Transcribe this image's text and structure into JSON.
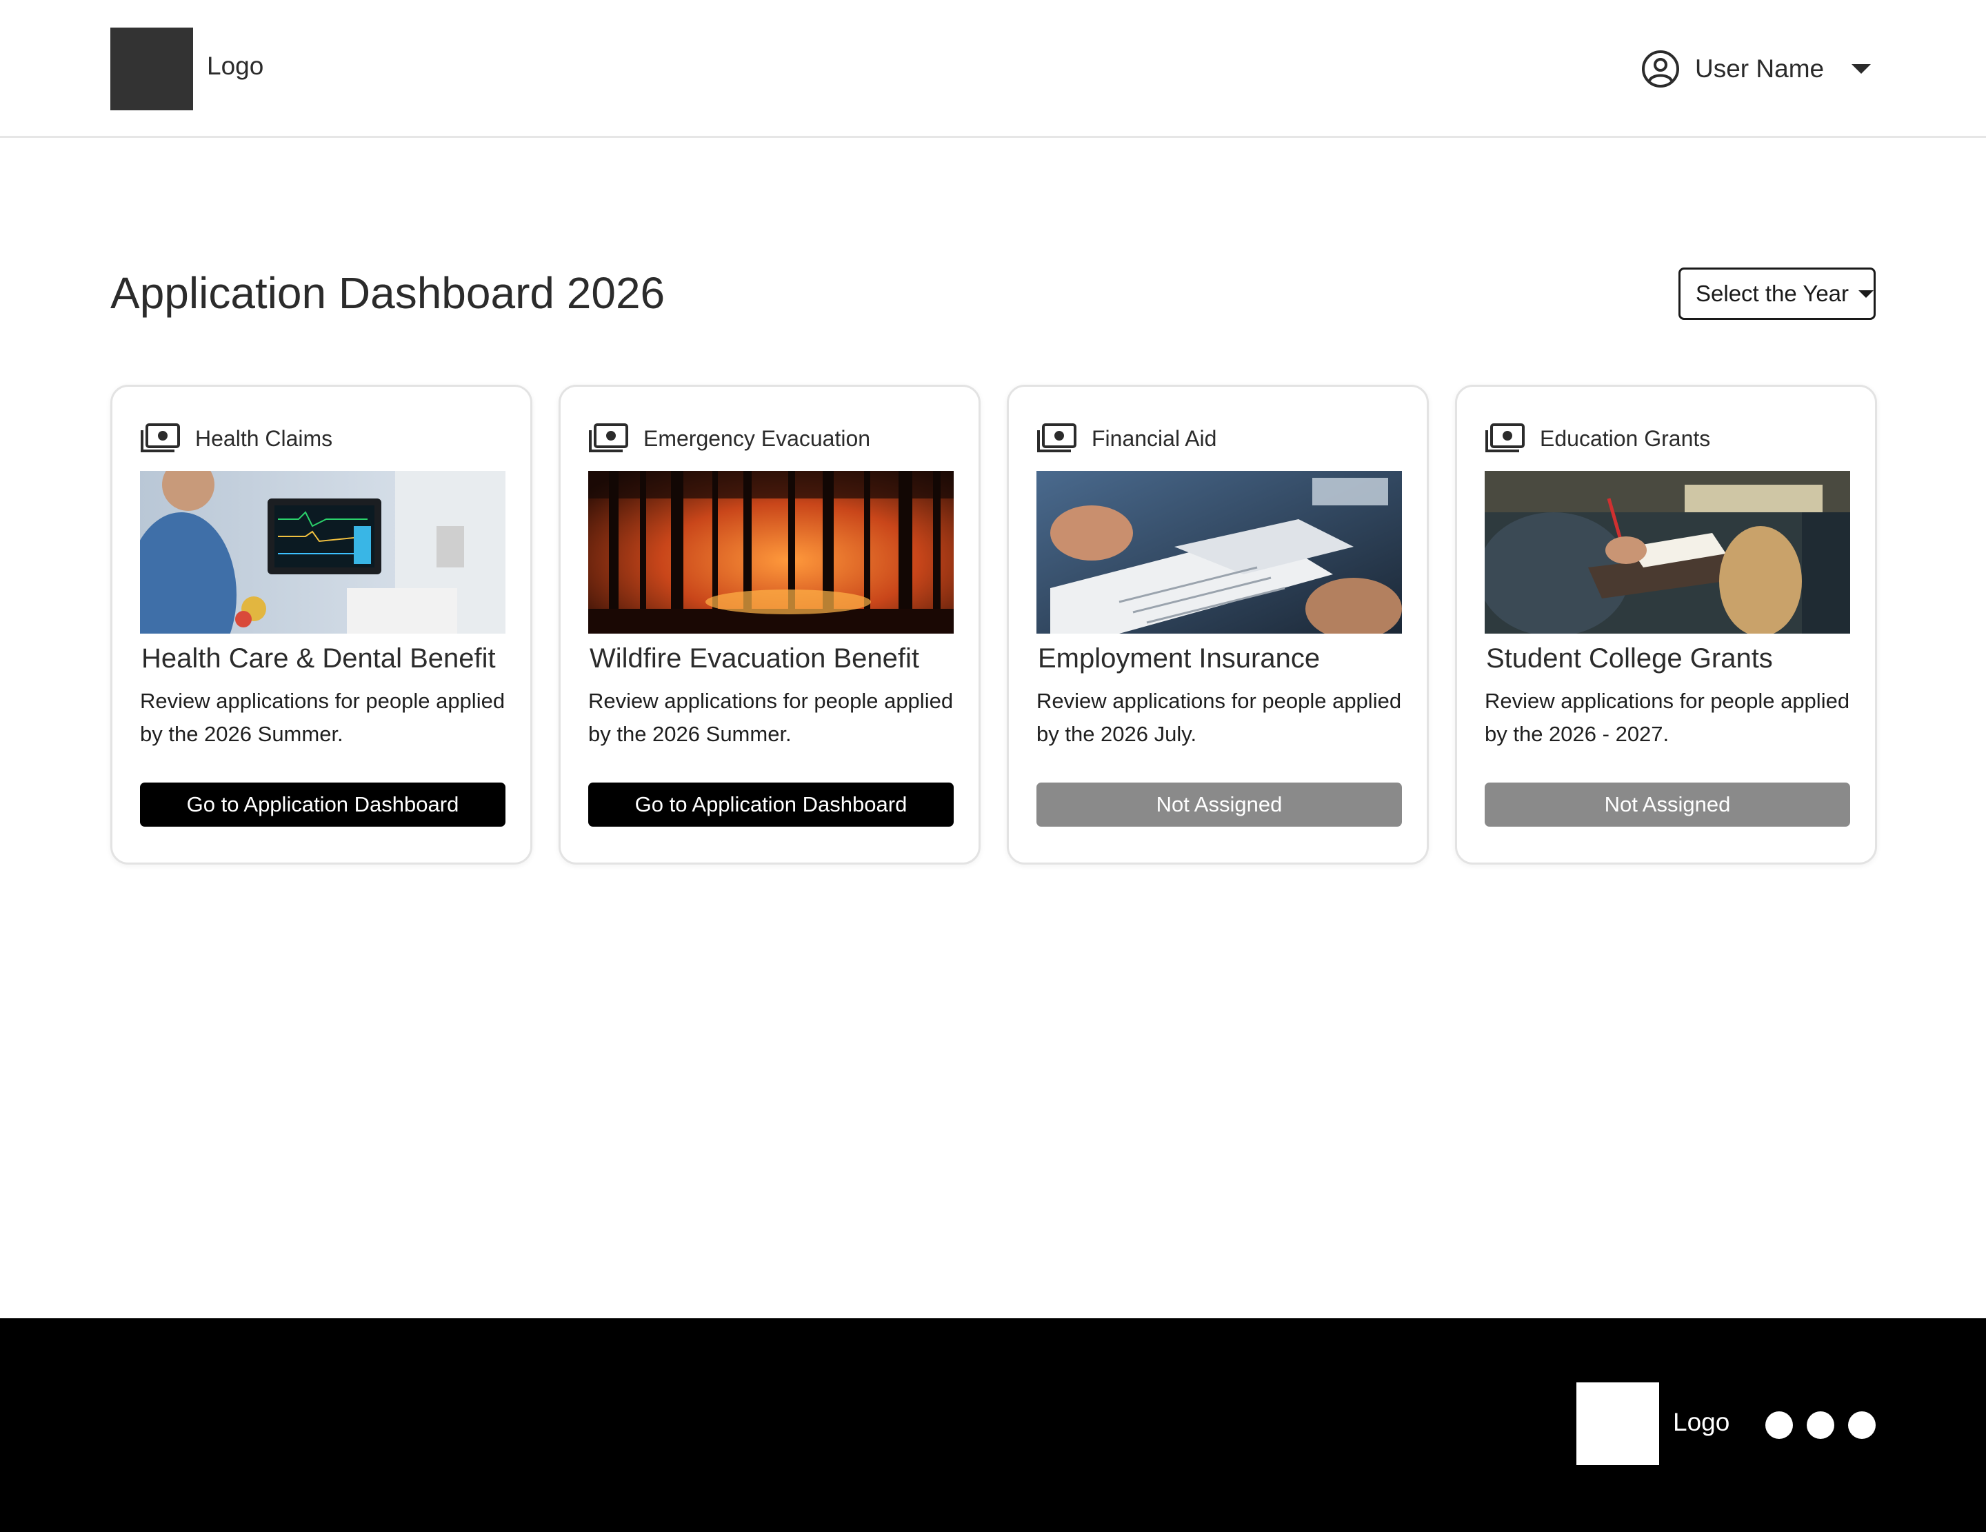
{
  "header": {
    "logo_text": "Logo",
    "user_name": "User Name"
  },
  "main": {
    "title": "Application Dashboard 2026",
    "year_select": {
      "label": "Select the Year"
    }
  },
  "cards": [
    {
      "category": "Health Claims",
      "title": "Health Care & Dental Benefit",
      "description": "Review applications for people applied by the 2026 Summer.",
      "button_label": "Go to Application Dashboard",
      "button_state": "active",
      "image": "hospital-monitor-image"
    },
    {
      "category": "Emergency Evacuation",
      "title": "Wildfire Evacuation Benefit",
      "description": "Review applications for people applied by the 2026 Summer.",
      "button_label": "Go to Application Dashboard",
      "button_state": "active",
      "image": "forest-fire-image"
    },
    {
      "category": "Financial Aid",
      "title": "Employment Insurance",
      "description": "Review applications for people applied by the 2026 July.",
      "button_label": "Not Assigned",
      "button_state": "disabled",
      "image": "paperwork-image"
    },
    {
      "category": "Education Grants",
      "title": "Student College Grants",
      "description": "Review applications for people applied by the 2026 - 2027.",
      "button_label": "Not Assigned",
      "button_state": "disabled",
      "image": "students-writing-image"
    }
  ],
  "footer": {
    "logo_text": "Logo",
    "social_dots": 3
  },
  "colors": {
    "primary_button": "#000000",
    "disabled_button": "#8a8a8a",
    "footer_bg": "#000000",
    "logo_box": "#333333"
  },
  "icons": {
    "user": "user-circle-icon",
    "category": "money-stack-icon",
    "dropdown": "chevron-down-icon"
  }
}
